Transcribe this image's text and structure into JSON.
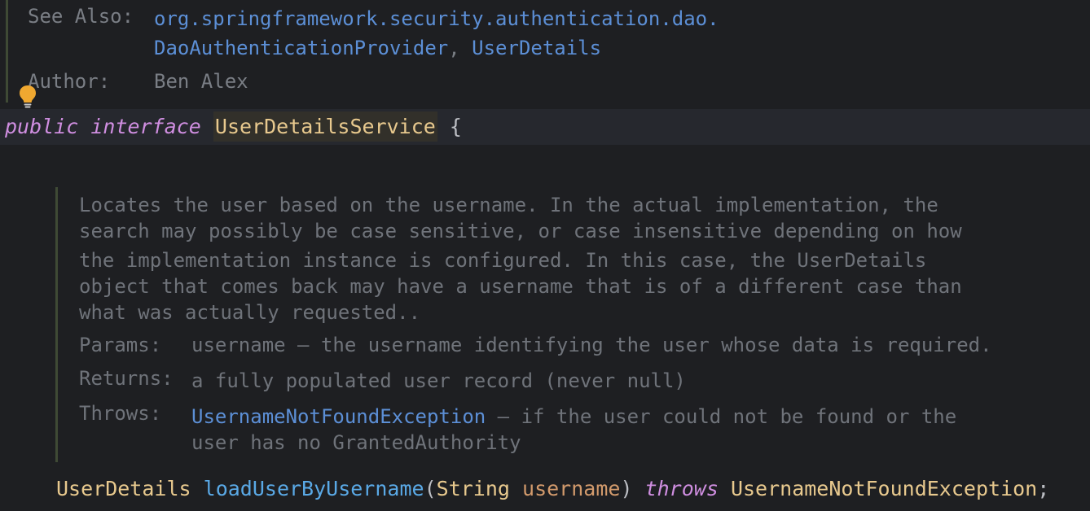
{
  "top_doc": {
    "see_also_label": "See Also:",
    "see_also_line1": "org.springframework.security.authentication.dao.",
    "see_also_link2": "DaoAuthenticationProvider",
    "see_also_sep": ",",
    "see_also_link3": "UserDetails",
    "author_label": "Author:",
    "author_value": "Ben Alex"
  },
  "declaration": {
    "kw_public": "public",
    "kw_interface": "interface",
    "name": "UserDetailsService",
    "brace": "{"
  },
  "method_doc": {
    "lines": [
      "Locates the user based on the username. In the actual implementation, the",
      "search may possibly be case sensitive, or case insensitive depending on how",
      "the implementation instance is configured. In this case, the UserDetails",
      "object that comes back may have a username that is of a different case than",
      "what was actually requested.."
    ],
    "params_label": "Params:",
    "params_value": "username – the username identifying the user whose data is required.",
    "returns_label": "Returns:",
    "returns_value": "a fully populated user record (never null)",
    "throws_label": "Throws:",
    "throws_link": "UsernameNotFoundException",
    "throws_text1": " – if the user could not be found or the",
    "throws_text2": "user has no GrantedAuthority"
  },
  "signature": {
    "return_type": "UserDetails",
    "method_name": "loadUserByUsername",
    "open_paren": "(",
    "param_type": "String",
    "param_name": "username",
    "close_paren": ")",
    "kw_throws": "throws",
    "exception": "UsernameNotFoundException",
    "semicolon": ";"
  },
  "icons": {
    "bulb": "lightbulb-icon"
  },
  "colors": {
    "background": "#1e1f22",
    "keyword": "#cf8ee0",
    "type": "#e8c98e",
    "link": "#5c8fd6",
    "method": "#5aa9e6",
    "param": "#d29a6c",
    "doc": "#7a7e85"
  }
}
